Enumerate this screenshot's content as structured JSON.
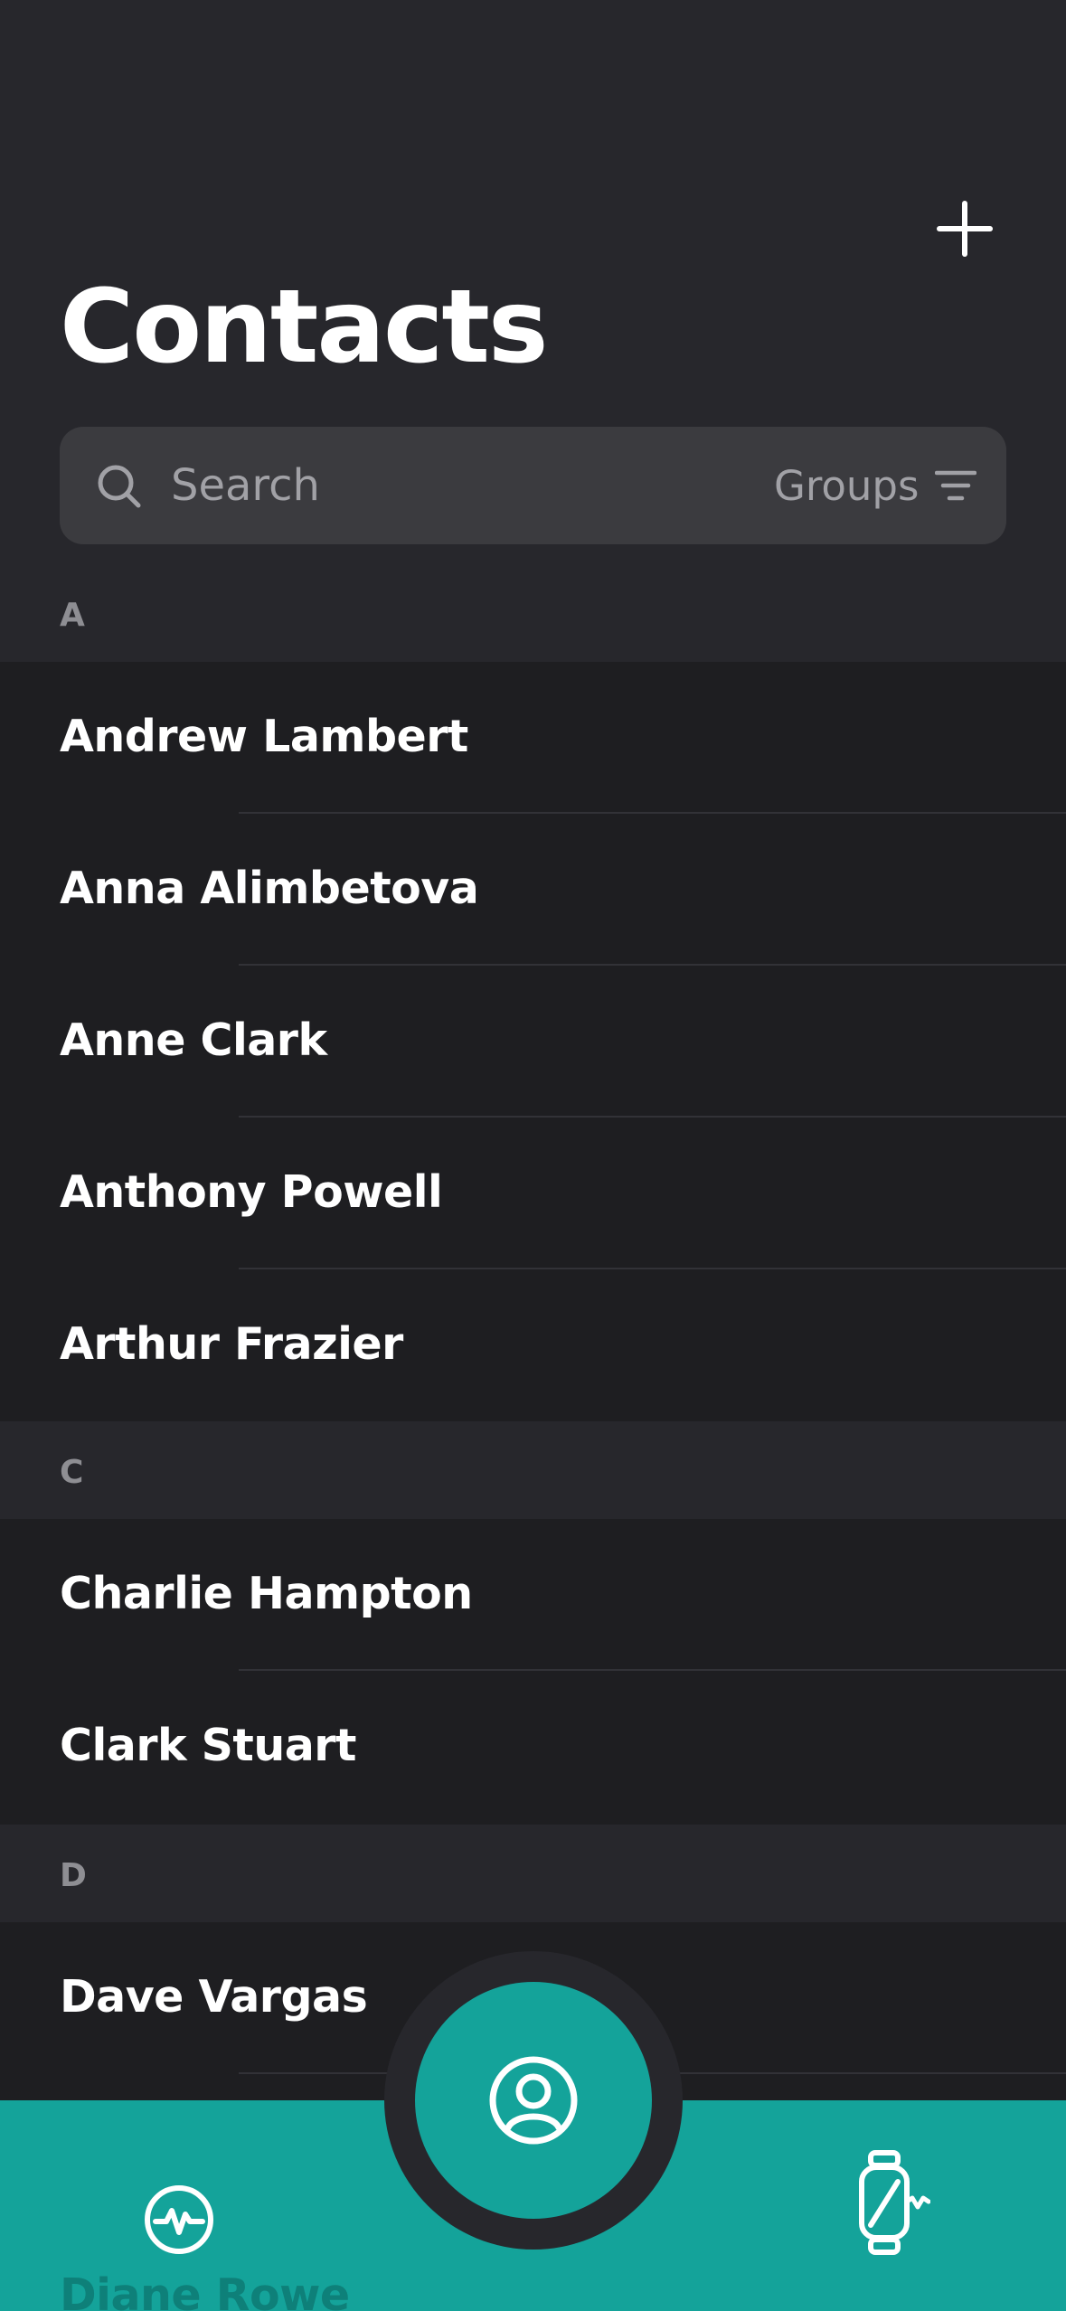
{
  "header": {
    "title": "Contacts",
    "add_icon": "plus-icon"
  },
  "search": {
    "placeholder": "Search",
    "value": "",
    "groups_label": "Groups"
  },
  "sections": [
    {
      "letter": "A",
      "contacts": [
        "Andrew Lambert",
        "Anna Alimbetova",
        "Anne Clark",
        "Anthony Powell",
        "Arthur Frazier"
      ]
    },
    {
      "letter": "C",
      "contacts": [
        "Charlie Hampton",
        "Clark Stuart"
      ]
    },
    {
      "letter": "D",
      "contacts": [
        "Dave Vargas",
        "Diane Rowe"
      ]
    }
  ],
  "tabbar": {
    "left_icon": "activity-pulse-icon",
    "center_icon": "user-profile-icon",
    "right_icon": "smartwatch-icon"
  },
  "colors": {
    "accent": "#14a39a",
    "background": "#1e1e21",
    "header_bg": "#27272c",
    "search_bg": "#3b3b3f"
  }
}
